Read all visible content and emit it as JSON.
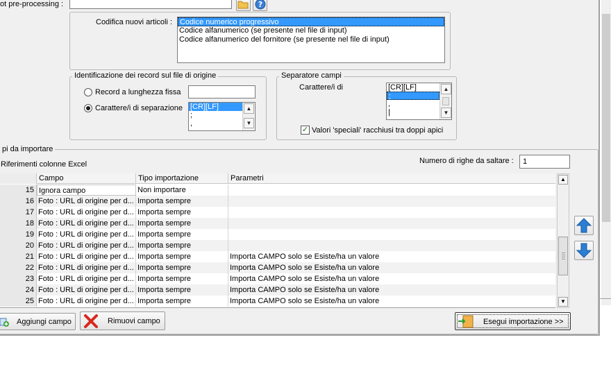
{
  "preprocessing": {
    "label": "ot pre-processing :"
  },
  "codifica": {
    "label": "Codifica nuovi articoli :",
    "options": [
      "Codice numerico progressivo",
      "Codice alfanumerico (se presente nel file di input)",
      "Codice alfanumerico del fornitore (se presente nel file di input)"
    ],
    "selected_index": 0
  },
  "identificazione": {
    "legend": "Identificazione dei record sul file di origine",
    "radio_fixed_label": "Record a lunghezza fissa",
    "radio_sep_label": "Carattere/i di separazione",
    "fixed_value": "",
    "sep_list": [
      "[CR][LF]",
      ";",
      ","
    ]
  },
  "separatore": {
    "legend": "Separatore campi",
    "label": "Carattere/i di",
    "list": [
      "[CR][LF]",
      ";",
      ",",
      "|"
    ],
    "selected_index": 1,
    "checkbox_label": "Valori 'speciali' racchiusi tra doppi apici",
    "checkbox_checked": true
  },
  "campi": {
    "legend": "pi da importare",
    "excel_label": "Riferimenti colonne Excel",
    "skip_label": "Numero di righe da saltare :",
    "skip_value": "1",
    "columns": [
      "Campo",
      "Tipo importazione",
      "Parametri"
    ],
    "rows": [
      {
        "n": "15",
        "campo": "Ignora campo",
        "tipo": "Non importare",
        "param": ""
      },
      {
        "n": "16",
        "campo": "Foto : URL di origine per d...",
        "tipo": "Importa sempre",
        "param": ""
      },
      {
        "n": "17",
        "campo": "Foto : URL di origine per d...",
        "tipo": "Importa sempre",
        "param": ""
      },
      {
        "n": "18",
        "campo": "Foto : URL di origine per d...",
        "tipo": "Importa sempre",
        "param": ""
      },
      {
        "n": "19",
        "campo": "Foto : URL di origine per d...",
        "tipo": "Importa sempre",
        "param": ""
      },
      {
        "n": "20",
        "campo": "Foto : URL di origine per d...",
        "tipo": "Importa sempre",
        "param": ""
      },
      {
        "n": "21",
        "campo": "Foto : URL di origine per d...",
        "tipo": "Importa sempre",
        "param": "Importa CAMPO solo se Esiste/ha un valore"
      },
      {
        "n": "22",
        "campo": "Foto : URL di origine per d...",
        "tipo": "Importa sempre",
        "param": "Importa CAMPO solo se Esiste/ha un valore"
      },
      {
        "n": "23",
        "campo": "Foto : URL di origine per d...",
        "tipo": "Importa sempre",
        "param": "Importa CAMPO solo se Esiste/ha un valore"
      },
      {
        "n": "24",
        "campo": "Foto : URL di origine per d...",
        "tipo": "Importa sempre",
        "param": "Importa CAMPO solo se Esiste/ha un valore"
      },
      {
        "n": "25",
        "campo": "Foto : URL di origine per d...",
        "tipo": "Importa sempre",
        "param": "Importa CAMPO solo se Esiste/ha un valore"
      }
    ]
  },
  "buttons": {
    "add": "Aggiungi campo",
    "remove": "Rimuovi campo",
    "execute": "Esegui importazione >>"
  },
  "colors": {
    "selection": "#3399ff",
    "arrow_blue": "#2a7fd4",
    "remove_red": "#d9281e"
  }
}
